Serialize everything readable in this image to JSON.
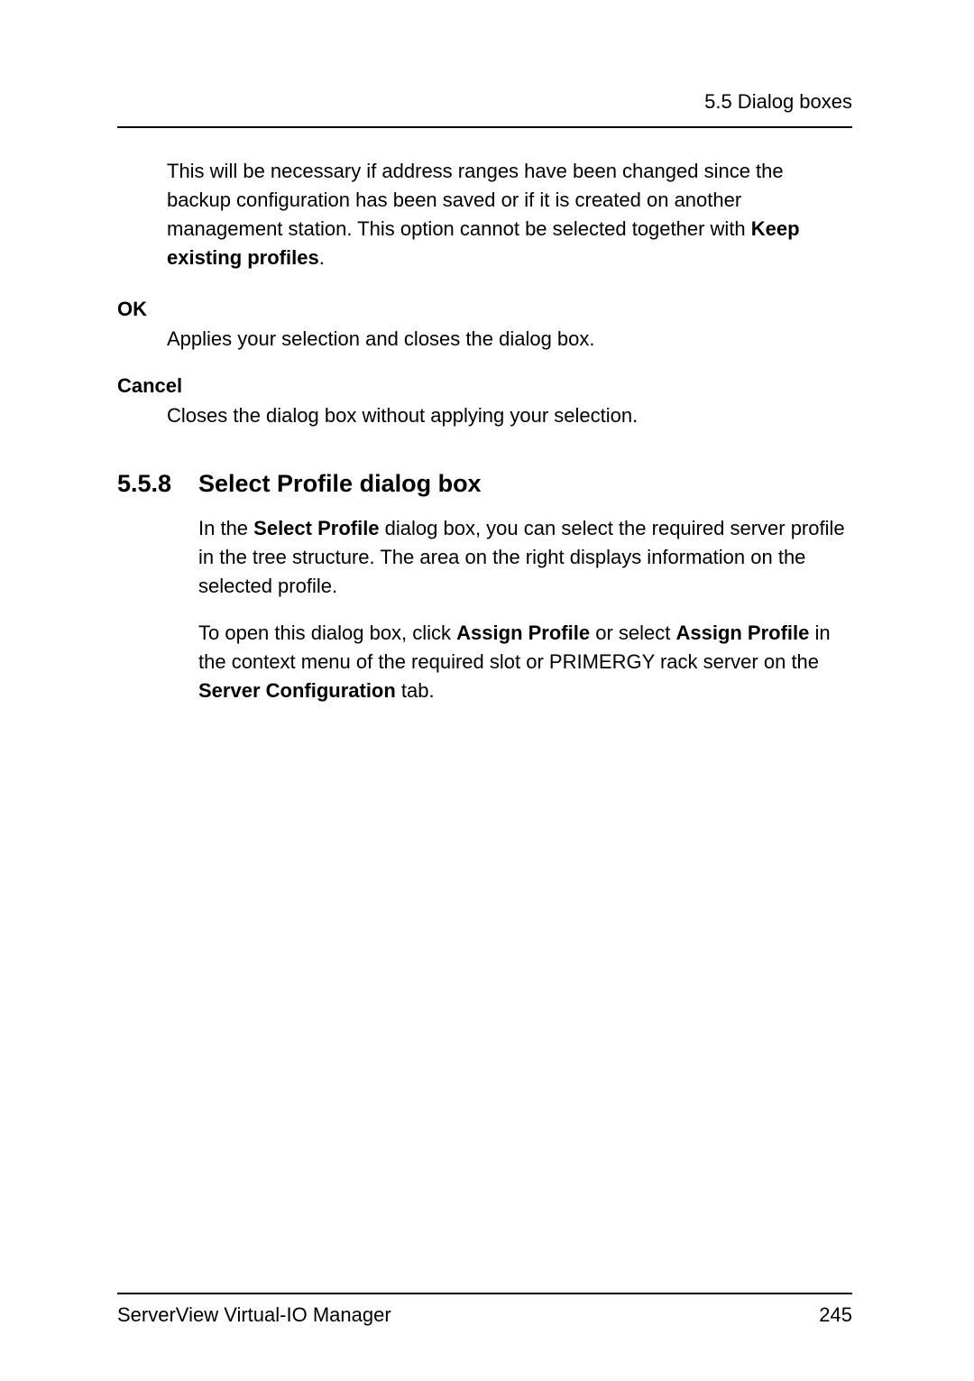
{
  "header": {
    "section_label": "5.5 Dialog boxes"
  },
  "continuation": {
    "paragraph_part1": "This will be necessary if address ranges have been changed since the backup configuration has been saved or if it is created on another management station. This option cannot be selected together with ",
    "bold_phrase": "Keep existing profiles",
    "paragraph_part2": "."
  },
  "definitions": [
    {
      "term": "OK",
      "description": "Applies your selection and closes the dialog box."
    },
    {
      "term": "Cancel",
      "description": "Closes the dialog box without applying your selection."
    }
  ],
  "section": {
    "number": "5.5.8",
    "title": "Select Profile dialog box",
    "paragraph1_part1": "In the ",
    "paragraph1_bold1": "Select Profile",
    "paragraph1_part2": " dialog box, you can select the required server profile in the tree structure. The area on the right displays information on the selected profile.",
    "paragraph2_part1": "To open this dialog box, click ",
    "paragraph2_bold1": "Assign Profile",
    "paragraph2_part2": " or select ",
    "paragraph2_bold2": "Assign Profile",
    "paragraph2_part3": " in the context menu of the required slot or PRIMERGY rack server on the ",
    "paragraph2_bold3": "Server Configuration",
    "paragraph2_part4": " tab."
  },
  "footer": {
    "title": "ServerView Virtual-IO Manager",
    "page_number": "245"
  }
}
